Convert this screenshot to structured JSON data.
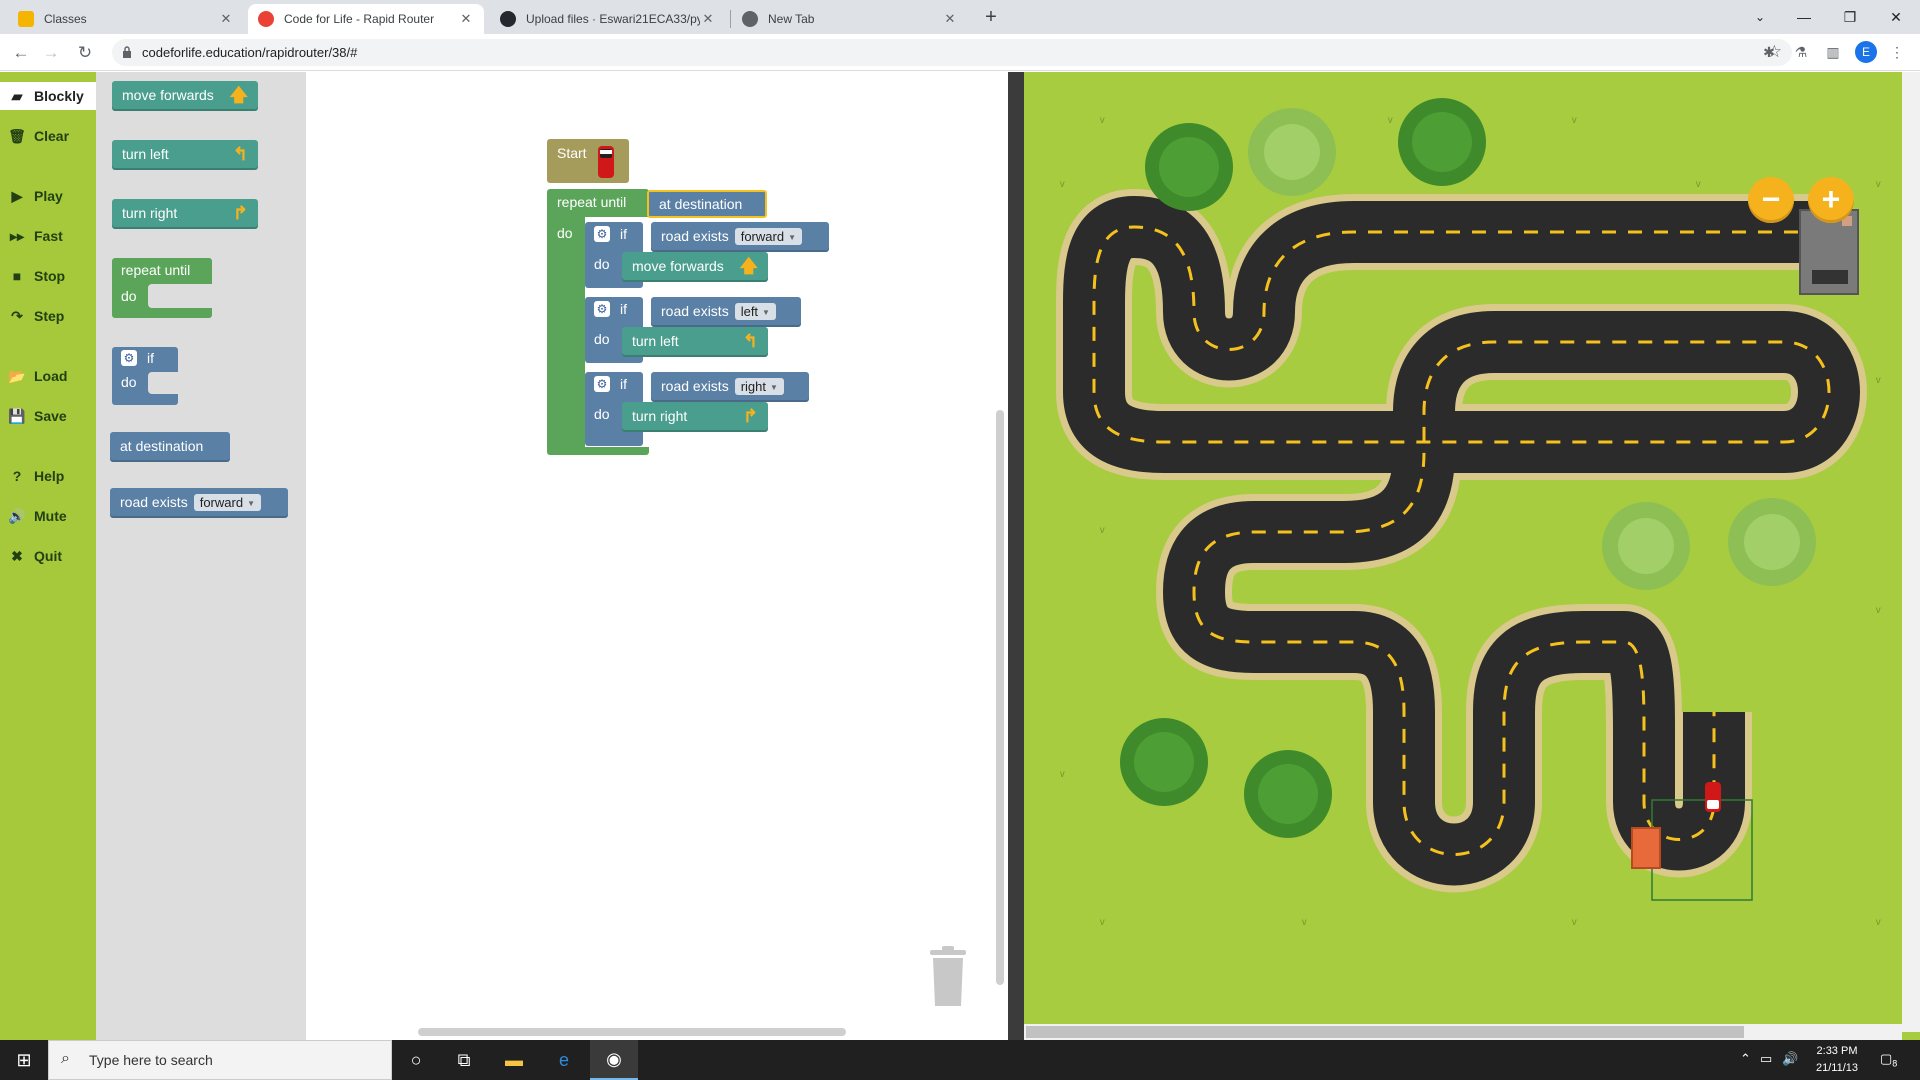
{
  "browser": {
    "tabs": [
      {
        "title": "Classes",
        "favicon_color": "#f5b400"
      },
      {
        "title": "Code for Life - Rapid Router",
        "favicon_color": "#ea4335"
      },
      {
        "title": "Upload files · Eswari21ECA33/pyt",
        "favicon_color": "#24292f"
      },
      {
        "title": "New Tab",
        "favicon_color": "#5f6368"
      }
    ],
    "url": "codeforlife.education/rapidrouter/38/#",
    "profile_initial": "E"
  },
  "menu": {
    "items": [
      {
        "label": "Blockly",
        "icon": "puzzle-icon"
      },
      {
        "label": "Clear",
        "icon": "trash-icon"
      },
      {
        "label": "Play",
        "icon": "play-icon"
      },
      {
        "label": "Fast",
        "icon": "fast-forward-icon"
      },
      {
        "label": "Stop",
        "icon": "stop-icon"
      },
      {
        "label": "Step",
        "icon": "step-icon"
      },
      {
        "label": "Load",
        "icon": "folder-icon"
      },
      {
        "label": "Save",
        "icon": "save-icon"
      },
      {
        "label": "Help",
        "icon": "help-icon"
      },
      {
        "label": "Mute",
        "icon": "speaker-icon"
      },
      {
        "label": "Quit",
        "icon": "close-icon"
      }
    ]
  },
  "toolbox": {
    "move_forwards": "move forwards",
    "turn_left": "turn left",
    "turn_right": "turn right",
    "repeat_until": "repeat until",
    "do": "do",
    "if": "if",
    "at_destination": "at destination",
    "road_exists": "road exists",
    "road_exists_option": "forward"
  },
  "program": {
    "start": "Start",
    "repeat_until": "repeat until",
    "condition": "at destination",
    "do": "do",
    "if_blocks": [
      {
        "if": "if",
        "condition": "road exists",
        "option": "forward",
        "do": "do",
        "action": "move forwards",
        "action_icon": "up-arrow-icon"
      },
      {
        "if": "if",
        "condition": "road exists",
        "option": "left",
        "do": "do",
        "action": "turn left",
        "action_icon": "left-turn-icon"
      },
      {
        "if": "if",
        "condition": "road exists",
        "option": "right",
        "do": "do",
        "action": "turn right",
        "action_icon": "right-turn-icon"
      }
    ]
  },
  "map": {
    "zoom_out": "−",
    "zoom_in": "+",
    "grass_color": "#a7cc3f",
    "road_color": "#2b2b2b"
  },
  "taskbar": {
    "search_placeholder": "Type here to search",
    "time": "2:33 PM",
    "date": "21/11/13",
    "notifications": "8"
  }
}
